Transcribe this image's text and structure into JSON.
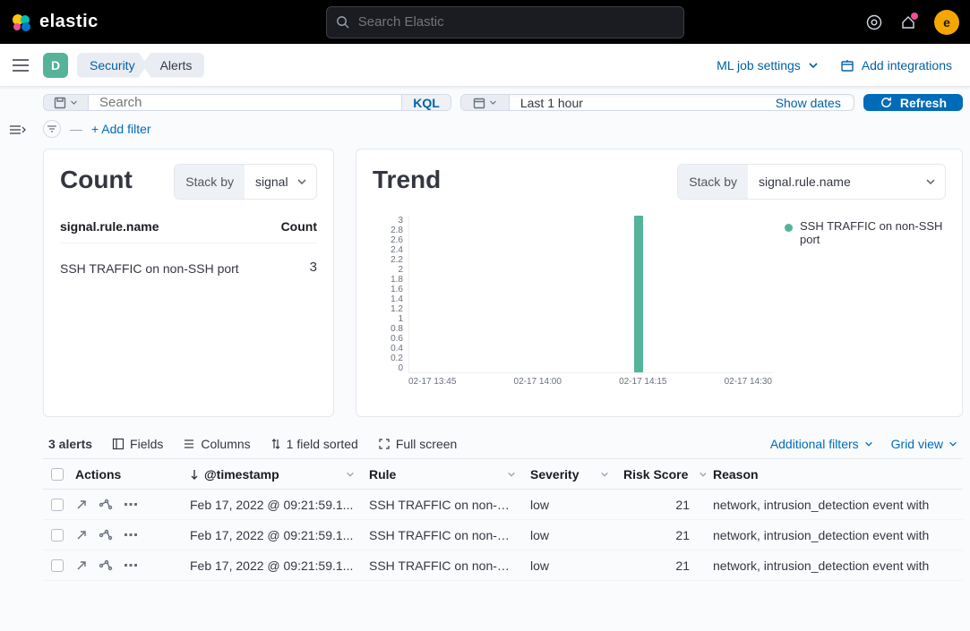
{
  "topbar": {
    "product": "elastic",
    "search_placeholder": "Search Elastic",
    "avatar_initial": "e"
  },
  "secbar": {
    "space_initial": "D",
    "breadcrumbs": [
      "Security",
      "Alerts"
    ],
    "ml_label": "ML job settings",
    "add_integrations": "Add integrations"
  },
  "query": {
    "search_placeholder": "Search",
    "kql": "KQL",
    "date_text": "Last 1 hour",
    "show_dates": "Show dates",
    "refresh": "Refresh",
    "add_filter": "+ Add filter"
  },
  "count_panel": {
    "title": "Count",
    "stack_by_label": "Stack by",
    "stack_by_value": "signal",
    "col_a": "signal.rule.name",
    "col_b": "Count",
    "row_name": "SSH TRAFFIC on non-SSH port",
    "row_count": "3"
  },
  "trend_panel": {
    "title": "Trend",
    "stack_by_label": "Stack by",
    "stack_by_value": "signal.rule.name",
    "legend": "SSH TRAFFIC on non-SSH port"
  },
  "chart_data": {
    "type": "bar",
    "title": "Trend",
    "ylabel": "",
    "xlabel": "",
    "ylim": [
      0,
      3
    ],
    "y_ticks": [
      "3",
      "2.8",
      "2.6",
      "2.4",
      "2.2",
      "2",
      "1.8",
      "1.6",
      "1.4",
      "1.2",
      "1",
      "0.8",
      "0.6",
      "0.4",
      "0.2",
      "0"
    ],
    "x_ticks": [
      "02-17 13:45",
      "02-17 14:00",
      "02-17 14:15",
      "02-17 14:30"
    ],
    "series": [
      {
        "name": "SSH TRAFFIC on non-SSH port",
        "x": "02-17 14:15",
        "value": 3
      }
    ],
    "bar": {
      "left_pct": 62,
      "height_pct": 100
    }
  },
  "table_toolbar": {
    "alerts_count": "3 alerts",
    "fields": "Fields",
    "columns": "Columns",
    "sorted": "1 field sorted",
    "full_screen": "Full screen",
    "additional_filters": "Additional filters",
    "grid_view": "Grid view"
  },
  "grid": {
    "headers": {
      "actions": "Actions",
      "timestamp": "@timestamp",
      "rule": "Rule",
      "severity": "Severity",
      "risk": "Risk Score",
      "reason": "Reason"
    },
    "rows": [
      {
        "timestamp": "Feb 17, 2022 @ 09:21:59.1...",
        "rule": "SSH TRAFFIC on non-SS...",
        "severity": "low",
        "risk": "21",
        "reason": "network, intrusion_detection event with"
      },
      {
        "timestamp": "Feb 17, 2022 @ 09:21:59.1...",
        "rule": "SSH TRAFFIC on non-SS...",
        "severity": "low",
        "risk": "21",
        "reason": "network, intrusion_detection event with"
      },
      {
        "timestamp": "Feb 17, 2022 @ 09:21:59.1...",
        "rule": "SSH TRAFFIC on non-SS...",
        "severity": "low",
        "risk": "21",
        "reason": "network, intrusion_detection event with"
      }
    ]
  }
}
